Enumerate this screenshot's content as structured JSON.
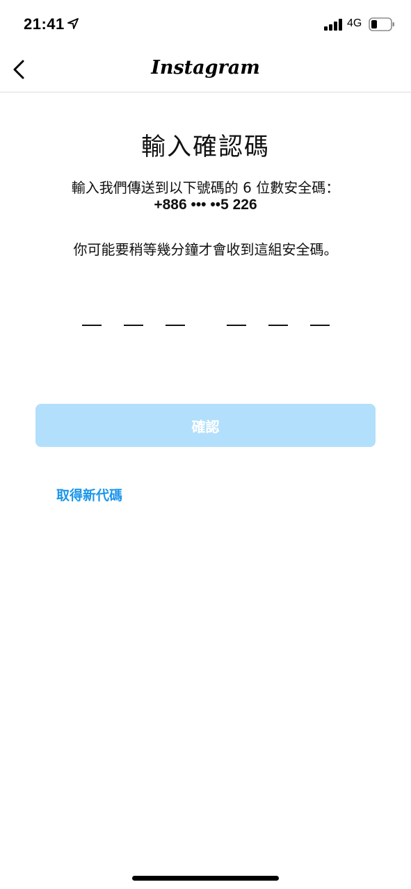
{
  "status_bar": {
    "time": "21:41",
    "network": "4G",
    "icons": [
      "location-arrow-icon",
      "signal-bars-icon",
      "battery-icon"
    ]
  },
  "nav": {
    "title": "Instagram",
    "back_icon": "chevron-left-icon"
  },
  "main": {
    "title": "輸入確認碼",
    "instruction": "輸入我們傳送到以下號碼的 6 位數安全碼：",
    "phone": "+886 ••• ••5 226",
    "note": "你可能要稍等幾分鐘才會收到這組安全碼。",
    "code_value": "",
    "code_length": 6
  },
  "actions": {
    "confirm_label": "確認",
    "confirm_color": "#b2dffc",
    "resend_label": "取得新代碼",
    "link_color": "#1a95ea"
  }
}
